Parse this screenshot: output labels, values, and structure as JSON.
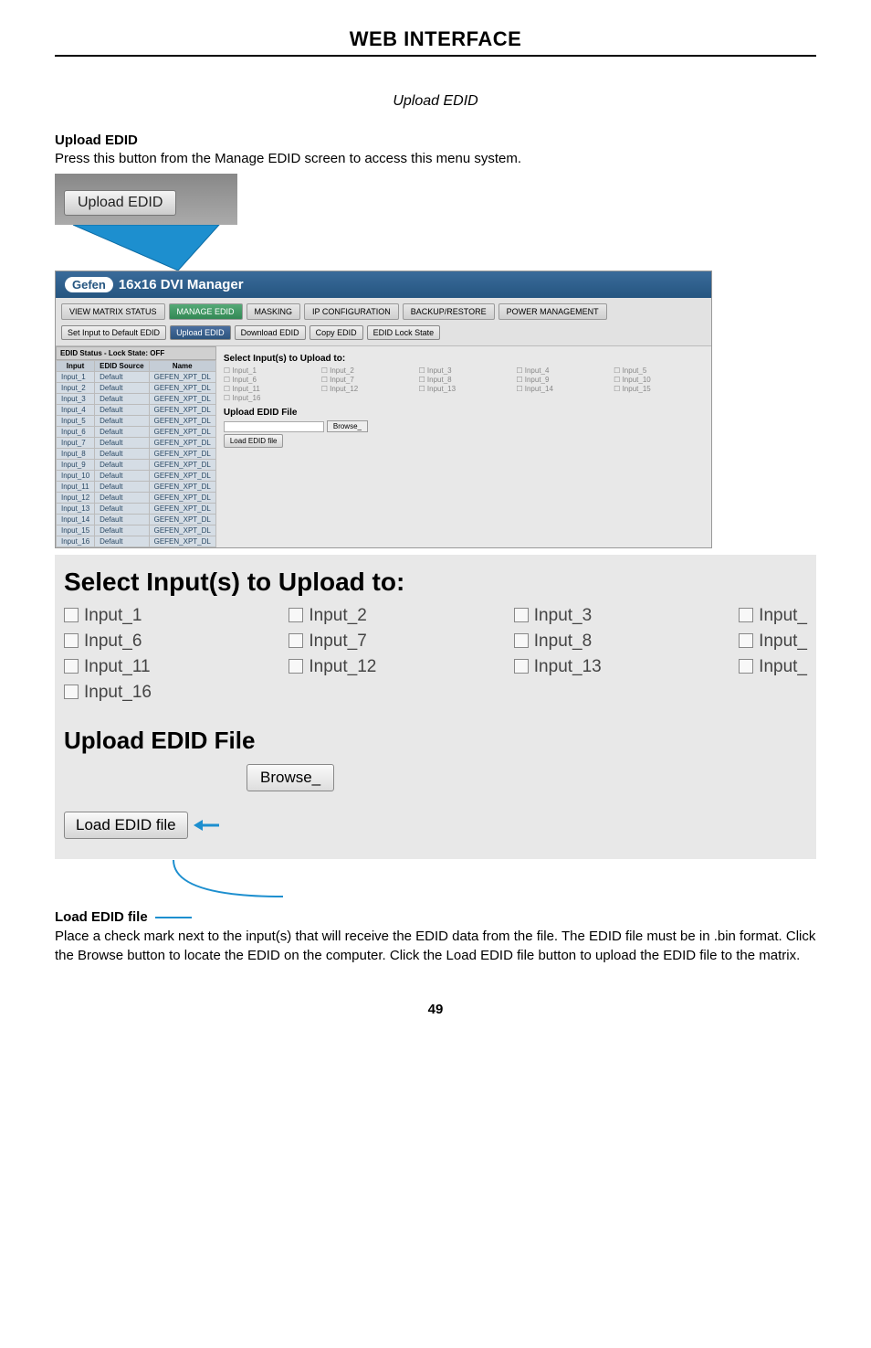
{
  "page": {
    "title": "WEB INTERFACE",
    "subtitle": "Upload EDID",
    "pageNumber": "49"
  },
  "intro": {
    "heading": "Upload EDID",
    "text": "Press this button from the Manage EDID screen to access this menu system."
  },
  "chip": {
    "label": "Upload EDID"
  },
  "app": {
    "brand": "Gefen",
    "title": "16x16 DVI Manager",
    "tabs": {
      "viewMatrix": "VIEW MATRIX STATUS",
      "manageEdid": "MANAGE EDID",
      "masking": "MASKING",
      "ipConfig": "IP CONFIGURATION",
      "backupRestore": "BACKUP/RESTORE",
      "powerMgmt": "POWER MANAGEMENT"
    },
    "subtabs": {
      "setDefault": "Set Input to Default EDID",
      "upload": "Upload EDID",
      "download": "Download EDID",
      "copy": "Copy EDID",
      "lockState": "EDID Lock State"
    },
    "statusBar": "EDID Status - Lock State: OFF",
    "tableHeaders": {
      "input": "Input",
      "source": "EDID Source",
      "name": "Name"
    },
    "rows": [
      {
        "in": "Input_1",
        "src": "Default",
        "name": "GEFEN_XPT_DL"
      },
      {
        "in": "Input_2",
        "src": "Default",
        "name": "GEFEN_XPT_DL"
      },
      {
        "in": "Input_3",
        "src": "Default",
        "name": "GEFEN_XPT_DL"
      },
      {
        "in": "Input_4",
        "src": "Default",
        "name": "GEFEN_XPT_DL"
      },
      {
        "in": "Input_5",
        "src": "Default",
        "name": "GEFEN_XPT_DL"
      },
      {
        "in": "Input_6",
        "src": "Default",
        "name": "GEFEN_XPT_DL"
      },
      {
        "in": "Input_7",
        "src": "Default",
        "name": "GEFEN_XPT_DL"
      },
      {
        "in": "Input_8",
        "src": "Default",
        "name": "GEFEN_XPT_DL"
      },
      {
        "in": "Input_9",
        "src": "Default",
        "name": "GEFEN_XPT_DL"
      },
      {
        "in": "Input_10",
        "src": "Default",
        "name": "GEFEN_XPT_DL"
      },
      {
        "in": "Input_11",
        "src": "Default",
        "name": "GEFEN_XPT_DL"
      },
      {
        "in": "Input_12",
        "src": "Default",
        "name": "GEFEN_XPT_DL"
      },
      {
        "in": "Input_13",
        "src": "Default",
        "name": "GEFEN_XPT_DL"
      },
      {
        "in": "Input_14",
        "src": "Default",
        "name": "GEFEN_XPT_DL"
      },
      {
        "in": "Input_15",
        "src": "Default",
        "name": "GEFEN_XPT_DL"
      },
      {
        "in": "Input_16",
        "src": "Default",
        "name": "GEFEN_XPT_DL"
      }
    ],
    "rightPane": {
      "selectHeading": "Select Input(s) to Upload to:",
      "inputs": [
        "Input_1",
        "Input_2",
        "Input_3",
        "Input_4",
        "Input_5",
        "Input_6",
        "Input_7",
        "Input_8",
        "Input_9",
        "Input_10",
        "Input_11",
        "Input_12",
        "Input_13",
        "Input_14",
        "Input_15",
        "Input_16"
      ],
      "uploadHeading": "Upload EDID File",
      "browse": "Browse_",
      "load": "Load EDID file"
    }
  },
  "zoom": {
    "selectHeading": "Select Input(s) to Upload to:",
    "items": [
      "Input_1",
      "Input_2",
      "Input_3",
      "Input_",
      "Input_6",
      "Input_7",
      "Input_8",
      "Input_",
      "Input_11",
      "Input_12",
      "Input_13",
      "Input_",
      "Input_16"
    ],
    "uploadHeading": "Upload EDID File",
    "browse": "Browse_",
    "load": "Load EDID file"
  },
  "footer": {
    "heading": "Load EDID file",
    "text": "Place a check mark next to the input(s) that will receive the EDID data from the file.  The EDID file must be in .bin format.  Click the Browse button to locate the EDID on the computer.  Click the Load EDID file button to upload the EDID file to the matrix."
  }
}
